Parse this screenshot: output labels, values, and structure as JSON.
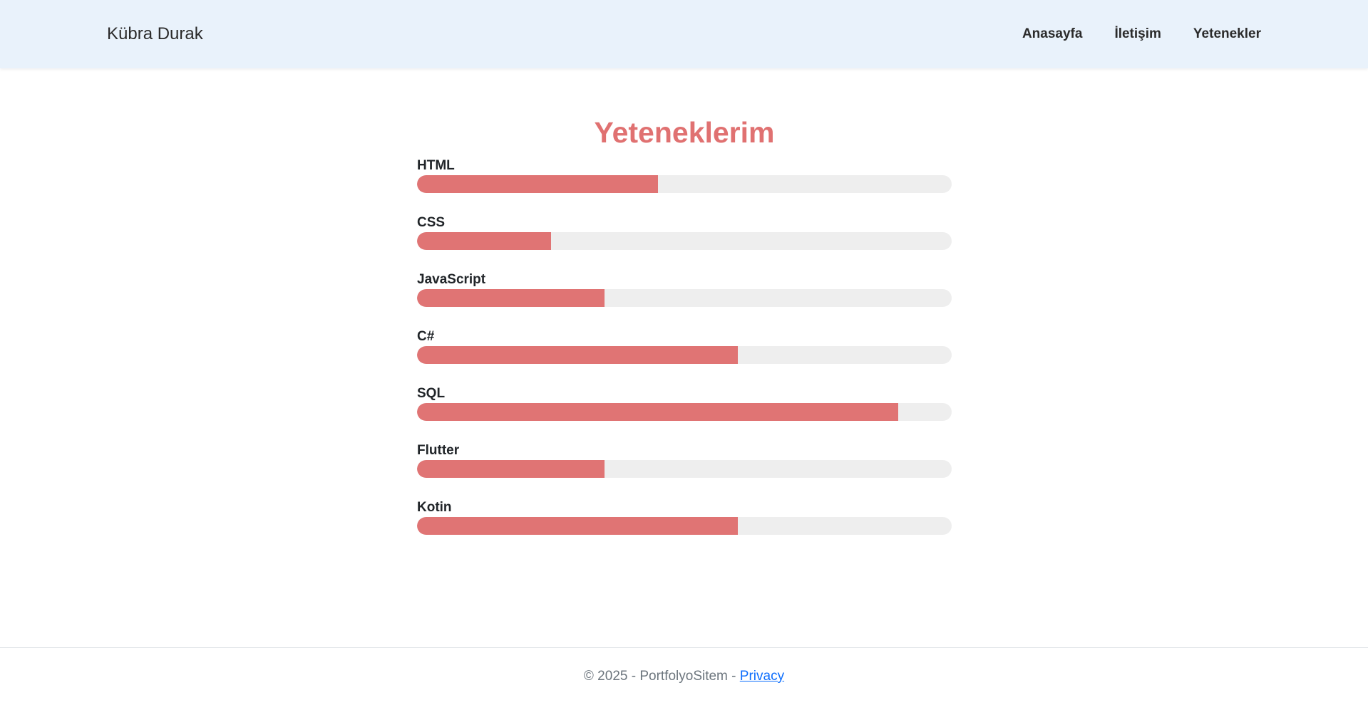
{
  "header": {
    "brand": "Kübra Durak",
    "nav": [
      {
        "label": "Anasayfa"
      },
      {
        "label": "İletişim"
      },
      {
        "label": "Yetenekler"
      }
    ]
  },
  "main": {
    "title": "Yeteneklerim",
    "skills": [
      {
        "name": "HTML",
        "level": 0.45
      },
      {
        "name": "CSS",
        "level": 0.25
      },
      {
        "name": "JavaScript",
        "level": 0.35
      },
      {
        "name": "C#",
        "level": 0.6
      },
      {
        "name": "SQL",
        "level": 0.9
      },
      {
        "name": "Flutter",
        "level": 0.35
      },
      {
        "name": "Kotin",
        "level": 0.6
      }
    ]
  },
  "footer": {
    "copyright": "© 2025 - PortfolyoSitem - ",
    "privacy_label": "Privacy"
  },
  "colors": {
    "header_bg": "#e9f2fb",
    "accent": "#e07474",
    "track": "#eeeeee",
    "link": "#0d6efd"
  }
}
